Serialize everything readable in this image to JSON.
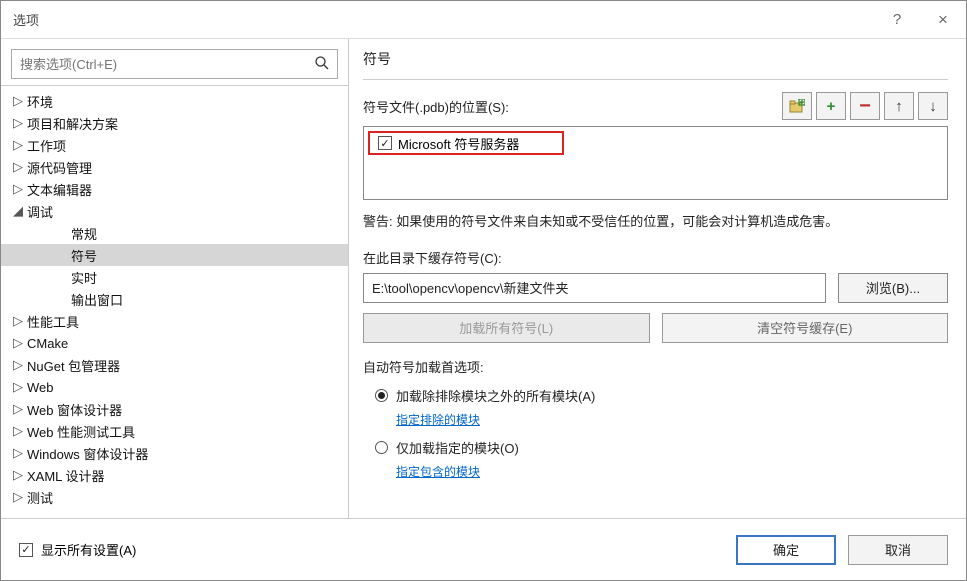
{
  "window": {
    "title": "选项"
  },
  "search": {
    "placeholder": "搜索选项(Ctrl+E)"
  },
  "tree": [
    {
      "label": "环境",
      "depth": 0,
      "arrow": "▷"
    },
    {
      "label": "项目和解决方案",
      "depth": 0,
      "arrow": "▷"
    },
    {
      "label": "工作项",
      "depth": 0,
      "arrow": "▷"
    },
    {
      "label": "源代码管理",
      "depth": 0,
      "arrow": "▷"
    },
    {
      "label": "文本编辑器",
      "depth": 0,
      "arrow": "▷"
    },
    {
      "label": "调试",
      "depth": 0,
      "arrow": "◢"
    },
    {
      "label": "常规",
      "depth": 2,
      "arrow": ""
    },
    {
      "label": "符号",
      "depth": 2,
      "arrow": "",
      "selected": true
    },
    {
      "label": "实时",
      "depth": 2,
      "arrow": ""
    },
    {
      "label": "输出窗口",
      "depth": 2,
      "arrow": ""
    },
    {
      "label": "性能工具",
      "depth": 0,
      "arrow": "▷"
    },
    {
      "label": "CMake",
      "depth": 0,
      "arrow": "▷"
    },
    {
      "label": "NuGet 包管理器",
      "depth": 0,
      "arrow": "▷"
    },
    {
      "label": "Web",
      "depth": 0,
      "arrow": "▷"
    },
    {
      "label": "Web 窗体设计器",
      "depth": 0,
      "arrow": "▷"
    },
    {
      "label": "Web 性能测试工具",
      "depth": 0,
      "arrow": "▷"
    },
    {
      "label": "Windows 窗体设计器",
      "depth": 0,
      "arrow": "▷"
    },
    {
      "label": "XAML 设计器",
      "depth": 0,
      "arrow": "▷"
    },
    {
      "label": "测试",
      "depth": 0,
      "arrow": "▷"
    }
  ],
  "page": {
    "title": "符号",
    "locations_label": "符号文件(.pdb)的位置(S):",
    "ms_symbol_server": "Microsoft 符号服务器",
    "warning": "警告: 如果使用的符号文件来自未知或不受信任的位置，可能会对计算机造成危害。",
    "cache_label": "在此目录下缓存符号(C):",
    "cache_value": "E:\\tool\\opencv\\opencv\\新建文件夹",
    "browse": "浏览(B)...",
    "load_all": "加载所有符号(L)",
    "clear_cache": "清空符号缓存(E)",
    "auto_section": "自动符号加载首选项:",
    "radio1": "加载除排除模块之外的所有模块(A)",
    "link1": "指定排除的模块",
    "radio2": "仅加载指定的模块(O)",
    "link2": "指定包含的模块"
  },
  "footer": {
    "show_all": "显示所有设置(A)",
    "ok": "确定",
    "cancel": "取消"
  }
}
